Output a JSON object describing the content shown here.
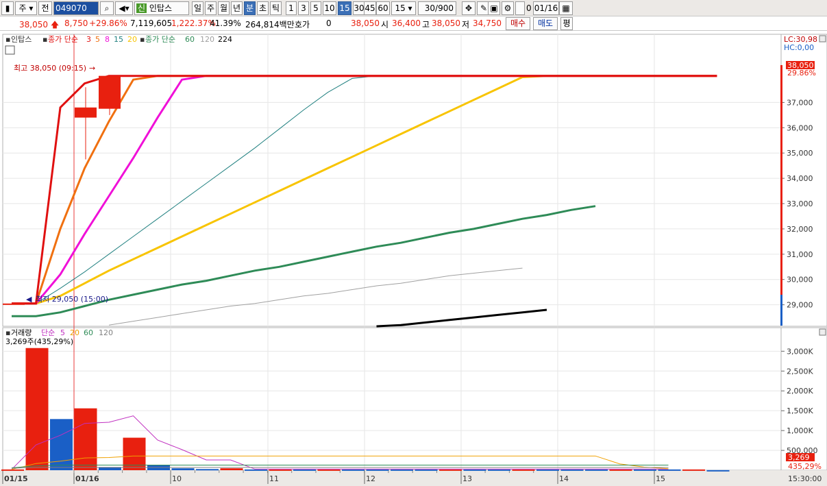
{
  "toolbar": {
    "market": "주",
    "prev": "전",
    "code": "049070",
    "stock_name": "인탑스",
    "stock_badge": "신",
    "periods": [
      "일",
      "주",
      "월",
      "년",
      "분",
      "초",
      "틱"
    ],
    "active_period": "분",
    "intervals": [
      "1",
      "3",
      "5",
      "10",
      "15",
      "30",
      "45",
      "60"
    ],
    "active_interval": "15",
    "interval_value": "15",
    "count": "30/900",
    "date": "01/16",
    "checkbox_label": "0"
  },
  "quote": {
    "price": "38,050",
    "change": "8,750",
    "change_pct": "+29.86%",
    "volume": "7,119,605",
    "volume_ratio": "1,222.37%",
    "turnover": "41.39%",
    "amount": "264,814백만",
    "hoga_label": "호가",
    "hoga_value": "0",
    "hoga_price": "38,050",
    "open_label": "시",
    "open": "36,400",
    "high_label": "고",
    "high": "38,050",
    "low_label": "저",
    "low": "34,750",
    "buy_label": "매수",
    "sell_label": "매도",
    "eval_label": "평"
  },
  "legend": {
    "name": "인탑스",
    "close_label": "종가 단순",
    "ma_short": [
      "3",
      "5",
      "8",
      "15",
      "20"
    ],
    "close_label2": "종가 단순",
    "ma_long": [
      "60",
      "120",
      "224"
    ],
    "lc": "LC:30,98",
    "hc": "HC:0,00"
  },
  "volume_legend": {
    "name": "거래량",
    "label": "단순",
    "mas": [
      "5",
      "20",
      "60",
      "120"
    ],
    "info": "3,269주(435,29%)"
  },
  "annotations": {
    "high": "최고 38,050 (09:15)",
    "low": "최저 29,050 (15:00)",
    "price_tag": "38,050",
    "pct_tag": "29.86%",
    "vol_tag": "3,269",
    "vol_pct_tag": "435,29%",
    "time": "15:30:00"
  },
  "colors": {
    "up": "#e8200f",
    "down": "#1a5fc6",
    "ma3": "#e01010",
    "ma5": "#f07010",
    "ma8": "#f010d8",
    "ma15": "#208080",
    "ma20": "#f8c400",
    "ma60": "#2e8b57",
    "ma120": "#a0a0a0",
    "ma224": "#000000"
  },
  "chart_data": [
    {
      "type": "candlestick",
      "title": "인탑스 15분",
      "x": [
        "01/15 15:00",
        "01/16 09:00",
        "01/16 09:15"
      ],
      "ohlc": [
        {
          "x": "01/15 15:00",
          "open": 29050,
          "high": 29050,
          "low": 29050,
          "close": 29050
        },
        {
          "x": "01/16 09:00",
          "open": 36400,
          "high": 37600,
          "low": 34750,
          "close": 36800
        },
        {
          "x": "01/16 09:15",
          "open": 36750,
          "high": 38050,
          "low": 36500,
          "close": 38050
        }
      ],
      "x_axis_labels": [
        "01/15",
        "01/16",
        "10",
        "11",
        "12",
        "13",
        "14",
        "15"
      ],
      "y_ticks": [
        29000,
        30000,
        31000,
        32000,
        33000,
        34000,
        35000,
        36000,
        37000,
        38050
      ],
      "y_tick_labels": [
        "29,000",
        "30,000",
        "31,000",
        "32,000",
        "33,000",
        "34,000",
        "35,000",
        "36,000",
        "37,000"
      ],
      "ylim": [
        28150,
        38800
      ],
      "series": [
        {
          "name": "3",
          "color": "#e01010",
          "values": [
            29050,
            29050,
            36800,
            37750,
            38050,
            38050,
            38050,
            38050,
            38050,
            38050,
            38050,
            38050,
            38050,
            38050,
            38050,
            38050,
            38050,
            38050,
            38050,
            38050,
            38050,
            38050,
            38050,
            38050,
            38050,
            38050,
            38050,
            38050,
            38050,
            38050
          ]
        },
        {
          "name": "5",
          "color": "#f07010",
          "values": [
            29050,
            29050,
            32000,
            34400,
            36250,
            37900,
            38050,
            38050,
            38050,
            38050,
            38050,
            38050,
            38050,
            38050,
            38050,
            38050,
            38050,
            38050,
            38050,
            38050,
            38050,
            38050,
            38050,
            38050,
            38050,
            38050,
            38050,
            38050,
            38050,
            38050
          ]
        },
        {
          "name": "8",
          "color": "#f010d8",
          "values": [
            29050,
            29050,
            30200,
            31800,
            33300,
            34800,
            36400,
            37900,
            38050,
            38050,
            38050,
            38050,
            38050,
            38050,
            38050,
            38050,
            38050,
            38050,
            38050,
            38050,
            38050,
            38050,
            38050,
            38050,
            38050,
            38050,
            38050,
            38050,
            38050,
            38050
          ]
        },
        {
          "name": "15",
          "color": "#208080",
          "values": [
            29050,
            29050,
            29650,
            30300,
            31000,
            31700,
            32400,
            33100,
            33800,
            34500,
            35200,
            35950,
            36700,
            37400,
            37950,
            38050,
            38050,
            38050,
            38050,
            38050,
            38050,
            38050,
            38050,
            38050,
            38050,
            38050,
            38050,
            38050,
            38050,
            38050
          ]
        },
        {
          "name": "20",
          "color": "#f8c400",
          "values": [
            29050,
            29050,
            29350,
            29850,
            30350,
            30800,
            31250,
            31700,
            32150,
            32600,
            33050,
            33500,
            33950,
            34400,
            34850,
            35300,
            35750,
            36200,
            36650,
            37100,
            37550,
            38000,
            38050,
            38050,
            38050,
            38050,
            38050,
            38050,
            38050,
            38050
          ]
        },
        {
          "name": "60",
          "color": "#2e8b57",
          "values": [
            28550,
            28550,
            28700,
            28950,
            29200,
            29400,
            29600,
            29800,
            29950,
            30150,
            30350,
            30500,
            30700,
            30900,
            31100,
            31300,
            31450,
            31650,
            31850,
            32000,
            32200,
            32400,
            32550,
            32750,
            32900
          ]
        },
        {
          "name": "120",
          "color": "#a0a0a0",
          "values": [
            28200,
            28350,
            28500,
            28650,
            28800,
            28950,
            29050,
            29200,
            29350,
            29450,
            29600,
            29750,
            29850,
            30000,
            30150,
            30250,
            30350,
            30450
          ]
        },
        {
          "name": "224",
          "color": "#000000",
          "values": [
            28150,
            28200,
            28300,
            28400,
            28500,
            28600,
            28700,
            28800
          ]
        }
      ]
    },
    {
      "type": "bar",
      "title": "거래량",
      "x_axis_labels": [
        "01/15",
        "01/16",
        "10",
        "11",
        "12",
        "13",
        "14",
        "15"
      ],
      "y_tick_labels": [
        "500,000",
        "1,000K",
        "1,500K",
        "2,000K",
        "2,500K",
        "3,000K"
      ],
      "ylim": [
        0,
        3300000
      ],
      "values": [
        20000,
        3080000,
        1290000,
        1560000,
        80000,
        820000,
        130000,
        50000,
        30000,
        50000,
        20000,
        20000,
        20000,
        20000,
        20000,
        20000,
        20000,
        20000,
        20000,
        20000,
        20000,
        20000,
        20000,
        20000,
        20000,
        20000,
        20000,
        20000,
        20000,
        3269
      ],
      "up": [
        true,
        true,
        false,
        true,
        false,
        true,
        false,
        false,
        false,
        true,
        false,
        true,
        false,
        true,
        false,
        false,
        false,
        false,
        true,
        false,
        false,
        true,
        false,
        false,
        false,
        true,
        false,
        false,
        true,
        false
      ],
      "series": [
        {
          "name": "5",
          "color": "#c030c0",
          "values": [
            20000,
            640000,
            880000,
            1180000,
            1210000,
            1370000,
            760000,
            520000,
            260000,
            260000,
            30000,
            30000,
            30000,
            30000,
            30000,
            30000,
            30000,
            30000,
            30000,
            30000,
            30000,
            30000,
            30000,
            30000,
            30000,
            30000,
            30000,
            30000
          ]
        },
        {
          "name": "20",
          "color": "#f0a000",
          "values": [
            20000,
            170000,
            230000,
            310000,
            320000,
            360000,
            360000,
            360000,
            360000,
            360000,
            360000,
            360000,
            360000,
            360000,
            360000,
            360000,
            360000,
            360000,
            360000,
            360000,
            360000,
            360000,
            360000,
            360000,
            360000,
            160000,
            80000,
            40000
          ]
        },
        {
          "name": "60",
          "color": "#2e8b57",
          "values": [
            60000,
            110000,
            130000,
            130000,
            130000,
            130000,
            130000,
            130000,
            130000,
            130000,
            130000,
            130000,
            130000,
            130000,
            130000,
            130000,
            130000,
            130000,
            130000,
            130000,
            130000,
            130000,
            130000,
            130000,
            130000,
            130000,
            130000,
            130000
          ]
        },
        {
          "name": "120",
          "color": "#808080",
          "values": [
            50000,
            70000,
            70000,
            70000,
            70000,
            70000,
            70000,
            70000,
            70000,
            70000,
            70000,
            70000,
            70000,
            70000,
            70000,
            70000,
            70000,
            70000,
            70000,
            70000,
            70000,
            70000,
            70000,
            70000,
            70000,
            70000,
            70000,
            70000
          ]
        }
      ]
    }
  ]
}
